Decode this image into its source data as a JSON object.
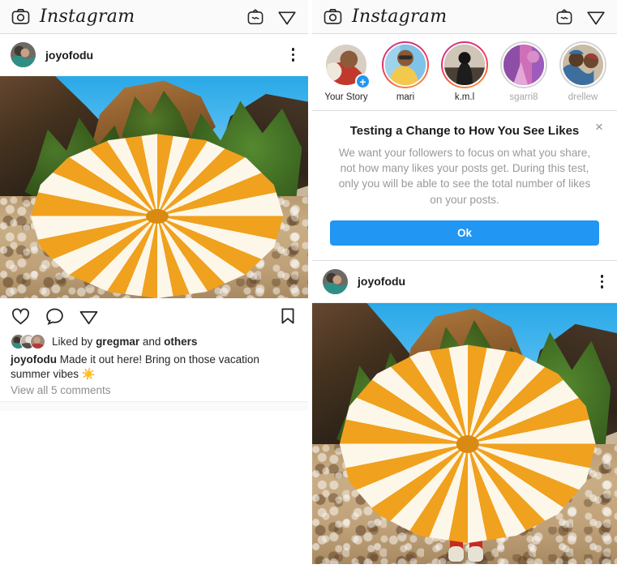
{
  "app": {
    "name": "Instagram",
    "accent_blue": "#2196f3",
    "icons": {
      "camera": "camera-icon",
      "igtv": "igtv-icon",
      "direct": "direct-share-icon",
      "like": "heart-icon",
      "comment": "comment-bubble-icon",
      "share": "share-paper-plane-icon",
      "save": "bookmark-icon",
      "more": "more-options-icon",
      "close": "close-icon",
      "add_story": "plus-badge-icon"
    }
  },
  "left_screen": {
    "header": {
      "title": "Instagram"
    },
    "post": {
      "username": "joyofodu",
      "likes_prefix": "Liked by",
      "likes_name": "gregmar",
      "likes_suffix": "and",
      "likes_others": "others",
      "caption_user": "joyofodu",
      "caption_text": "Made it out here! Bring on those vacation summer vibes ☀️",
      "comments_link": "View all 5 comments"
    }
  },
  "right_screen": {
    "header": {
      "title": "Instagram"
    },
    "stories": [
      {
        "label": "Your Story",
        "state": "own",
        "has_add_badge": true
      },
      {
        "label": "mari",
        "state": "unseen",
        "has_add_badge": false
      },
      {
        "label": "k.m.l",
        "state": "unseen",
        "has_add_badge": false
      },
      {
        "label": "sgarri8",
        "state": "seen",
        "has_add_badge": false
      },
      {
        "label": "drellew",
        "state": "seen",
        "has_add_badge": false
      }
    ],
    "dialog": {
      "title": "Testing a Change to How You See Likes",
      "body": "We want your followers to focus on what you share, not how many likes your posts get. During this test, only you will be able to see the total number of likes on your posts.",
      "primary_button": "Ok",
      "close_label": "×"
    },
    "post": {
      "username": "joyofodu"
    }
  }
}
